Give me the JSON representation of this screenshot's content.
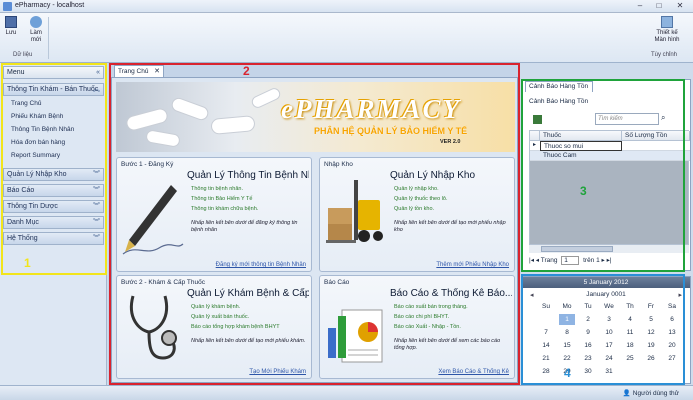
{
  "window": {
    "title": "ePharmacy - localhost"
  },
  "ribbon": {
    "save_label": "Lưu",
    "refresh_label": "Làm mới",
    "group_data": "Dữ liệu",
    "design_label": "Thiết kế Màn hình",
    "group_custom": "Tùy chỉnh"
  },
  "sidebar": {
    "menu_label": "Menu",
    "groups": [
      {
        "label": "Thông Tin Khám - Bán Thuốc"
      },
      {
        "label": "Quản Lý Nhập Kho"
      },
      {
        "label": "Báo Cáo"
      },
      {
        "label": "Thông Tin Dược"
      },
      {
        "label": "Danh Mục"
      },
      {
        "label": "Hệ Thống"
      }
    ],
    "items": [
      "Trang Chủ",
      "Phiếu Khám Bệnh",
      "Thông Tin Bệnh Nhân",
      "Hóa đơn bán hàng",
      "Report Summary"
    ]
  },
  "main": {
    "tab_label": "Trang Chủ",
    "banner": {
      "brand": "ePHARMACY",
      "subtitle": "PHÂN HỆ QUẢN LÝ BẢO HIỂM Y TẾ",
      "version": "VER 2.0"
    },
    "cards": [
      {
        "step": "Bước 1 - Đăng Ký",
        "heading": "Quản Lý Thông Tin Bệnh Nhân",
        "lines": [
          "Thông tin bệnh nhân.",
          "Thông tin Bảo Hiểm Y Tế",
          "Thông tin khám chữa bệnh."
        ],
        "note": "Nhấp liên kết bên dưới để đăng ký thông tin bệnh nhân",
        "link": "Đăng ký mới thông tin Bệnh Nhân"
      },
      {
        "step": "Nhập Kho",
        "heading": "Quản Lý Nhập Kho",
        "lines": [
          "Quản lý nhập kho.",
          "Quản lý thuốc theo lô.",
          "Quản lý tồn kho."
        ],
        "note": "Nhấp liên kết bên dưới để tạo mới phiếu nhập kho",
        "link": "Thêm mới Phiếu Nhập Kho"
      },
      {
        "step": "Bước 2 - Khám & Cấp Thuốc",
        "heading": "Quản Lý Khám Bệnh & Cấp...",
        "lines": [
          "Quản lý khám bệnh.",
          "Quản lý xuất bán thuốc.",
          "Báo cáo tổng hợp khám bệnh BHYT"
        ],
        "note": "Nhấp liên kết bên dưới để tạo mới phiếu khám.",
        "link": "Tạo Mới Phiếu Khám"
      },
      {
        "step": "Báo Cáo",
        "heading": "Báo Cáo & Thống Kê Báo...",
        "lines": [
          "Báo cáo xuất bán trong tháng.",
          "Báo cáo chi phí BHYT.",
          "Báo cáo Xuất - Nhập - Tồn."
        ],
        "note": "Nhấp liên kết bên dưới để xem các báo cáo tổng hợp.",
        "link": "Xem Báo Cáo & Thống Kê"
      }
    ]
  },
  "warning_panel": {
    "title": "Cảnh Báo Hàng Tồn",
    "tab_label": "Cảnh Báo Hàng Tồn",
    "label": "Cảnh Báo Hàng Tồn",
    "search_placeholder": "Tìm kiếm",
    "columns": [
      "Thuốc",
      "Số Lượng Tồn"
    ],
    "rows": [
      {
        "drug": "Thuoc so mui",
        "qty": ""
      },
      {
        "drug": "Thuoc Cam",
        "qty": ""
      }
    ],
    "nav": {
      "page_label": "Trang",
      "page": "1",
      "of_label": "trên 1"
    }
  },
  "calendar": {
    "today": "5 January 2012",
    "month": "January 0001",
    "weekdays": [
      "Su",
      "Mo",
      "Tu",
      "We",
      "Th",
      "Fr",
      "Sa"
    ],
    "weeks": [
      [
        "",
        "1",
        "2",
        "3",
        "4",
        "5",
        "6"
      ],
      [
        "7",
        "8",
        "9",
        "10",
        "11",
        "12",
        "13"
      ],
      [
        "14",
        "15",
        "16",
        "17",
        "18",
        "19",
        "20"
      ],
      [
        "21",
        "22",
        "23",
        "24",
        "25",
        "26",
        "27"
      ],
      [
        "28",
        "29",
        "30",
        "31",
        "",
        "",
        ""
      ]
    ],
    "selected": "1"
  },
  "status": {
    "user_label": "Người dùng thử"
  },
  "annotations": [
    "1",
    "2",
    "3",
    "4"
  ],
  "colors": {
    "box1": "#f2e51a",
    "box2": "#d9232e",
    "box3": "#1fa33b",
    "box4": "#2a8fd6"
  }
}
